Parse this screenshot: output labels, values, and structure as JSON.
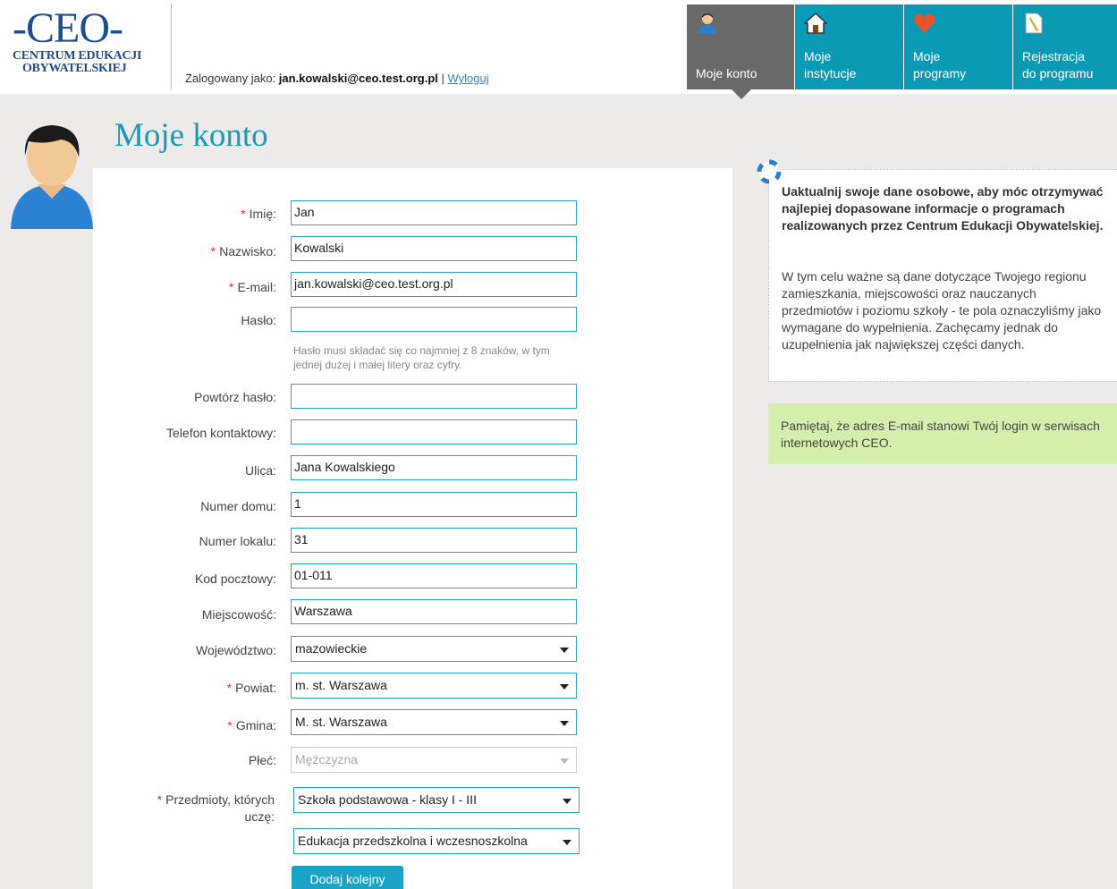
{
  "header": {
    "logo": {
      "mark": "-CEO-",
      "line1": "CENTRUM EDUKACJI",
      "line2": "OBYWATELSKIEJ"
    },
    "login_prefix": "Zalogowany jako: ",
    "login_user": "jan.kowalski@ceo.test.org.pl",
    "separator": " | ",
    "logout": "Wyloguj"
  },
  "nav": [
    {
      "label": "Moje konto",
      "icon": "user-icon",
      "active": true
    },
    {
      "label": "Moje\ninstytucje",
      "icon": "house-icon"
    },
    {
      "label": "Moje\nprogramy",
      "icon": "heart-icon"
    },
    {
      "label": "Rejestracja\ndo programu",
      "icon": "document-pen-icon"
    }
  ],
  "page": {
    "title": "Moje konto"
  },
  "form": {
    "imie_label": "Imię:",
    "imie_value": "Jan",
    "nazwisko_label": "Nazwisko:",
    "nazwisko_value": "Kowalski",
    "email_label": "E-mail:",
    "email_value": "jan.kowalski@ceo.test.org.pl",
    "haslo_label": "Hasło:",
    "haslo_value": "",
    "haslo_hint": "Hasło musi składać się co najmniej z 8 znaków, w tym jednej dużej i małej litery oraz cyfry.",
    "powtorz_label": "Powtórz hasło:",
    "powtorz_value": "",
    "telefon_label": "Telefon kontaktowy:",
    "telefon_value": "",
    "ulica_label": "Ulica:",
    "ulica_value": "Jana Kowalskiego",
    "numer_domu_label": "Numer domu:",
    "numer_domu_value": "1",
    "numer_lokalu_label": "Numer lokalu:",
    "numer_lokalu_value": "31",
    "kod_label": "Kod pocztowy:",
    "kod_value": "01-011",
    "miejscowosc_label": "Miejscowość:",
    "miejscowosc_value": "Warszawa",
    "wojewodztwo_label": "Województwo:",
    "wojewodztwo_value": "mazowieckie",
    "powiat_label": "Powiat:",
    "powiat_value": "m. st. Warszawa",
    "gmina_label": "Gmina:",
    "gmina_value": "M. st. Warszawa",
    "plec_label": "Płeć:",
    "plec_value": "Mężczyzna",
    "przedmioty_label_1": "Przedmioty, których",
    "przedmioty_label_2": "uczę:",
    "przedmioty_value_1": "Szkoła podstawowa - klasy I - III",
    "przedmioty_value_2": "Edukacja przedszkolna i wczesnoszkolna",
    "add_button": "Dodaj kolejny",
    "required_mark": "*"
  },
  "info": {
    "bold": "Uaktualnij swoje dane osobowe, aby móc otrzymywać najlepiej dopasowane informacje o programach realizowanych przez Centrum Edukacji Obywatelskiej.",
    "text": "W tym celu ważne są dane dotyczące Twojego regionu zamieszkania, miejscowości oraz nauczanych przedmiotów i poziomu szkoły - te pola oznaczyliśmy jako wymagane do wypełnienia. Zachęcamy jednak do uzupełnienia jak największej części danych.",
    "note": "Pamiętaj, że adres E-mail stanowi Twój login w serwisach internetowych CEO."
  },
  "colors": {
    "accent": "#0a9ab6",
    "nav_active": "#696969",
    "title": "#1a9ab8",
    "note_bg": "#d4eeab"
  }
}
